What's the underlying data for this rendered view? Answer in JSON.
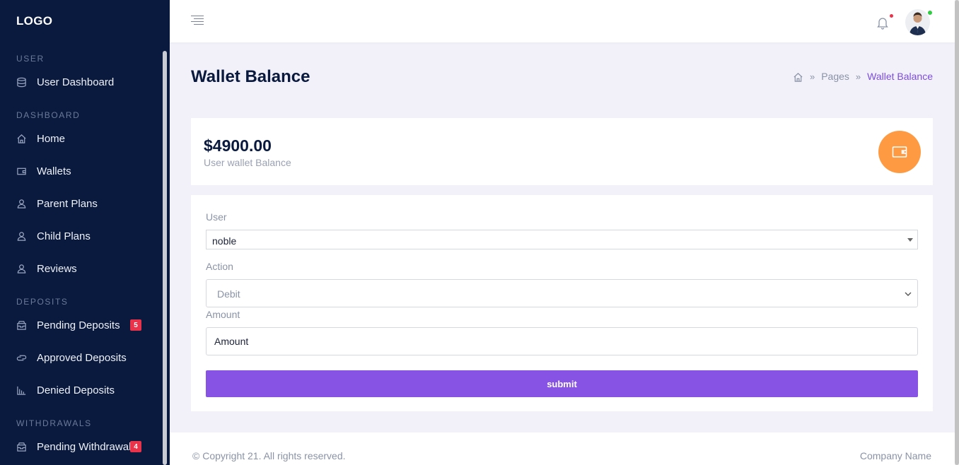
{
  "sidebar": {
    "logo": "LOGO",
    "sections": [
      {
        "label": "USER"
      },
      {
        "label": "DASHBOARD"
      },
      {
        "label": "DEPOSITS"
      },
      {
        "label": "WITHDRAWALS"
      }
    ],
    "items": [
      {
        "label": "User Dashboard",
        "icon": "database-icon"
      },
      {
        "label": "Home",
        "icon": "home-icon"
      },
      {
        "label": "Wallets",
        "icon": "wallet-icon"
      },
      {
        "label": "Parent Plans",
        "icon": "user-icon"
      },
      {
        "label": "Child Plans",
        "icon": "user-icon"
      },
      {
        "label": "Reviews",
        "icon": "user-icon"
      },
      {
        "label": "Pending Deposits",
        "icon": "inbox-icon",
        "badge": "5"
      },
      {
        "label": "Approved Deposits",
        "icon": "exchange-icon"
      },
      {
        "label": "Denied Deposits",
        "icon": "bar-chart-icon"
      },
      {
        "label": "Pending Withdrawals",
        "icon": "inbox-icon",
        "badge": "4"
      }
    ]
  },
  "header": {
    "notification_icon": "bell-icon",
    "avatar_icon": "avatar"
  },
  "page": {
    "title": "Wallet Balance",
    "breadcrumb": [
      "Pages",
      "Wallet Balance"
    ]
  },
  "balance": {
    "amount": "$4900.00",
    "label": "User wallet Balance",
    "icon": "wallet-icon",
    "accent": "#fe9b42"
  },
  "form": {
    "user_label": "User",
    "user_value": "noble",
    "action_label": "Action",
    "action_value": "Debit",
    "amount_label": "Amount",
    "amount_placeholder": "Amount",
    "submit_label": "submit",
    "submit_color": "#8753e5"
  },
  "footer": {
    "copyright": "© Copyright 21. All rights reserved.",
    "company": "Company Name"
  }
}
